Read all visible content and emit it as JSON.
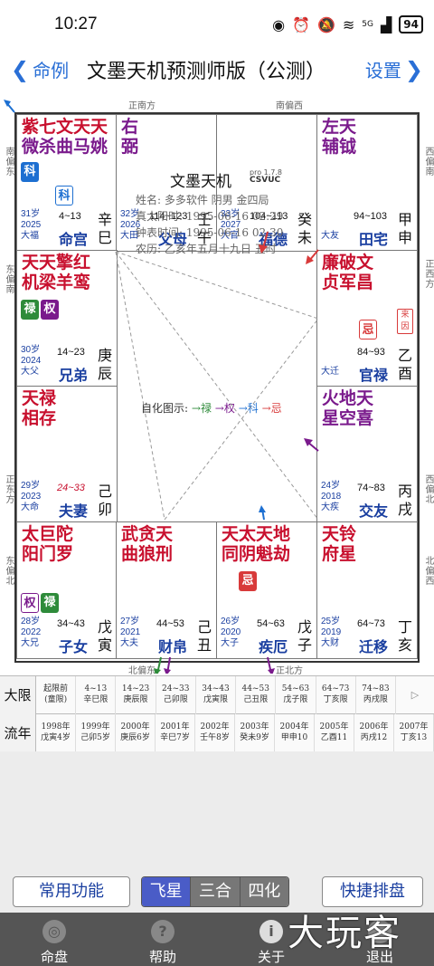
{
  "status": {
    "time": "10:27",
    "battery": "94",
    "signal": "5G"
  },
  "nav": {
    "back_label": "命例",
    "title": "文墨天机预测师版（公测）",
    "settings_label": "设置"
  },
  "directions": {
    "top_left": "正南方",
    "top_right": "南偏西",
    "left_top": "南偏东",
    "left_mid": "东偏南",
    "left_low": "正东方",
    "left_bot": "东偏北",
    "right_top": "西偏南",
    "right_mid": "正西方",
    "right_low": "西偏北",
    "right_bot": "北偏西",
    "bottom_left": "北偏东",
    "bottom_right": "正北方"
  },
  "palaces": [
    {
      "id": "si",
      "stars_row1": "紫七文天天",
      "stars_row2": "微杀曲马姚",
      "age": "31岁",
      "year": "2025",
      "daxian_tag": "大福",
      "range": "4~13",
      "name": "命宫",
      "gz1": "辛",
      "gz2": "巳",
      "badges": [
        "科",
        "科"
      ]
    },
    {
      "id": "wu",
      "stars_row1": "右",
      "stars_row2": "弼",
      "age": "32岁",
      "year": "2026",
      "daxian_tag": "大田",
      "range": "114~123",
      "name": "父母",
      "gz1": "壬",
      "gz2": "午"
    },
    {
      "id": "wei",
      "stars_row1": "",
      "stars_row2": "",
      "age": "33岁",
      "year": "2027",
      "daxian_tag": "大官",
      "range": "104~113",
      "name": "福德",
      "gz1": "癸",
      "gz2": "未"
    },
    {
      "id": "shen",
      "stars_row1": "左天",
      "stars_row2": "辅钺",
      "age": "",
      "year": "",
      "daxian_tag": "大友",
      "range": "94~103",
      "name": "田宅",
      "gz1": "甲",
      "gz2": "申"
    },
    {
      "id": "chen",
      "stars_row1": "天天擎红",
      "stars_row2": "机梁羊鸾",
      "age": "30岁",
      "year": "2024",
      "daxian_tag": "大父",
      "range": "14~23",
      "name": "兄弟",
      "gz1": "庚",
      "gz2": "辰",
      "badges": [
        "禄",
        "权"
      ]
    },
    {
      "id": "you",
      "stars_row1": "廉破文",
      "stars_row2": "贞军昌",
      "age": "",
      "year": "",
      "daxian_tag": "大迁",
      "range": "84~93",
      "name": "官禄",
      "gz1": "乙",
      "gz2": "酉",
      "badges": [
        "忌"
      ],
      "laiyin": "来因"
    },
    {
      "id": "mao",
      "stars_row1": "天禄",
      "stars_row2": "相存",
      "age": "29岁",
      "year": "2023",
      "daxian_tag": "大命",
      "range": "24~33",
      "name": "夫妻",
      "gz1": "己",
      "gz2": "卯"
    },
    {
      "id": "xu",
      "stars_row1": "火地天",
      "stars_row2": "星空喜",
      "age": "24岁",
      "year": "2018",
      "daxian_tag": "大疾",
      "range": "74~83",
      "name": "交友",
      "gz1": "丙",
      "gz2": "戌"
    },
    {
      "id": "yin",
      "stars_row1": "太巨陀",
      "stars_row2": "阳门罗",
      "age": "28岁",
      "year": "2022",
      "daxian_tag": "大兄",
      "range": "34~43",
      "name": "子女",
      "gz1": "戊",
      "gz2": "寅",
      "badges": [
        "权",
        "禄"
      ]
    },
    {
      "id": "chou",
      "stars_row1": "武贪天",
      "stars_row2": "曲狼刑",
      "age": "27岁",
      "year": "2021",
      "daxian_tag": "大夫",
      "range": "44~53",
      "name": "财帛",
      "gz1": "己",
      "gz2": "丑"
    },
    {
      "id": "zi",
      "stars_row1": "天太天地",
      "stars_row2": "同阴魁劫",
      "age": "26岁",
      "year": "2020",
      "daxian_tag": "大子",
      "range": "54~63",
      "name": "疾厄",
      "gz1": "戊",
      "gz2": "子",
      "badges": [
        "忌"
      ]
    },
    {
      "id": "hai",
      "stars_row1": "天铃",
      "stars_row2": "府星",
      "age": "25岁",
      "year": "2019",
      "daxian_tag": "大财",
      "range": "64~73",
      "name": "迁移",
      "gz1": "丁",
      "gz2": "亥"
    }
  ],
  "center": {
    "logo": "文墨天机",
    "version": "pro 1.7.8",
    "code": "CSVUC",
    "line1": "姓名: 多多软件   阴男 金四局",
    "line2": "真太阳时: 1995-06-16 02:29",
    "line3": "钟表时间: 1995-06-16 02:30",
    "line4": "农历: 乙亥年五月十九日 丑时",
    "hua_label": "自化图示:",
    "hua_lu": "禄",
    "hua_quan": "权",
    "hua_ke": "科",
    "hua_ji": "忌"
  },
  "daxian": {
    "label": "大限",
    "cells": [
      [
        "起限前",
        "(童限)"
      ],
      [
        "4~13",
        "辛巳限"
      ],
      [
        "14~23",
        "庚辰限"
      ],
      [
        "24~33",
        "己卯限"
      ],
      [
        "34~43",
        "戊寅限"
      ],
      [
        "44~53",
        "己丑限"
      ],
      [
        "54~63",
        "戊子限"
      ],
      [
        "64~73",
        "丁亥限"
      ],
      [
        "74~83",
        "丙戌限"
      ]
    ],
    "more": "▷"
  },
  "liunian": {
    "label": "流年",
    "cells": [
      [
        "1998年",
        "戊寅4岁"
      ],
      [
        "1999年",
        "己卯5岁"
      ],
      [
        "2000年",
        "庚辰6岁"
      ],
      [
        "2001年",
        "辛巳7岁"
      ],
      [
        "2002年",
        "壬午8岁"
      ],
      [
        "2003年",
        "癸未9岁"
      ],
      [
        "2004年",
        "甲申10"
      ],
      [
        "2005年",
        "乙酉11"
      ],
      [
        "2006年",
        "丙戌12"
      ],
      [
        "2007年",
        "丁亥13"
      ]
    ]
  },
  "buttons": {
    "common": "常用功能",
    "quick": "快捷排盘"
  },
  "segments": [
    "飞星",
    "三合",
    "四化"
  ],
  "tabs": [
    {
      "label": "命盘",
      "icon": "◎"
    },
    {
      "label": "帮助",
      "icon": "?"
    },
    {
      "label": "关于",
      "icon": "i"
    },
    {
      "label": "退出",
      "icon": ""
    }
  ],
  "watermark": "大玩客",
  "colors": {
    "red": "#c8102e",
    "purple": "#7a1a8c",
    "blue": "#1a3fa0",
    "accent": "#2a6fd6"
  }
}
